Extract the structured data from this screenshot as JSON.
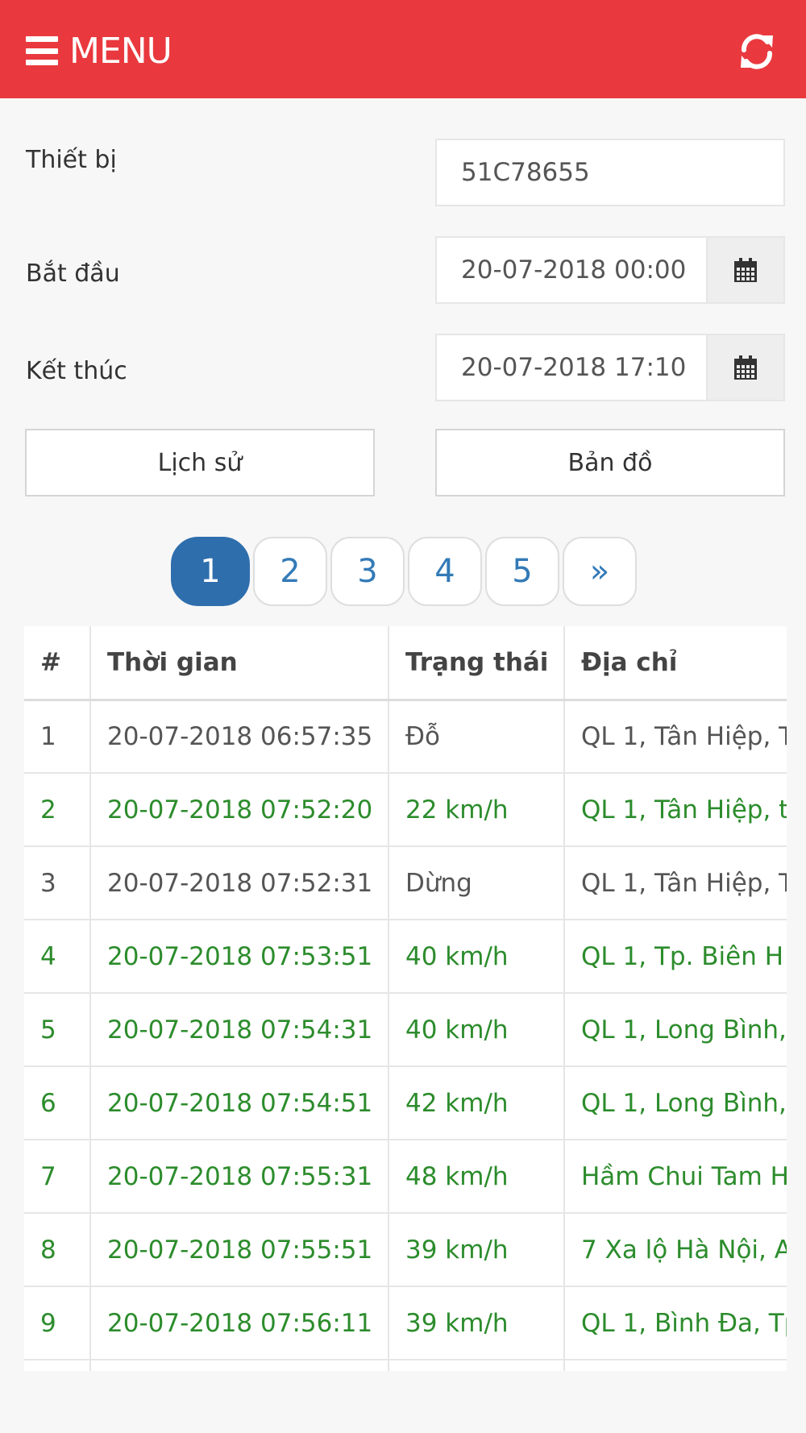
{
  "header": {
    "menu_label": "MENU",
    "menu_icon": "hamburger-icon",
    "refresh_icon": "refresh-icon",
    "accent": "#e9393e"
  },
  "form": {
    "device_label": "Thiết bị",
    "device_value": "51C78655",
    "start_label": "Bắt đầu",
    "start_value": "20-07-2018 00:00",
    "end_label": "Kết thúc",
    "end_value": "20-07-2018 17:10",
    "calendar_icon": "calendar-icon"
  },
  "buttons": {
    "history": "Lịch sử",
    "map": "Bản đồ"
  },
  "pagination": {
    "pages": [
      "1",
      "2",
      "3",
      "4",
      "5"
    ],
    "next": "»",
    "active": "1"
  },
  "table": {
    "headers": [
      "#",
      "Thời gian",
      "Trạng thái",
      "Địa chỉ"
    ],
    "rows": [
      {
        "no": "1",
        "time": "20-07-2018 06:57:35",
        "status": "Đỗ",
        "address": "QL 1, Tân Hiệp, T",
        "moving": false
      },
      {
        "no": "2",
        "time": "20-07-2018 07:52:20",
        "status": "22 km/h",
        "address": "QL 1, Tân Hiệp, t",
        "moving": true
      },
      {
        "no": "3",
        "time": "20-07-2018 07:52:31",
        "status": "Dừng",
        "address": "QL 1, Tân Hiệp, T",
        "moving": false
      },
      {
        "no": "4",
        "time": "20-07-2018 07:53:51",
        "status": "40 km/h",
        "address": "QL 1, Tp. Biên H",
        "moving": true
      },
      {
        "no": "5",
        "time": "20-07-2018 07:54:31",
        "status": "40 km/h",
        "address": "QL 1, Long Bình,",
        "moving": true
      },
      {
        "no": "6",
        "time": "20-07-2018 07:54:51",
        "status": "42 km/h",
        "address": "QL 1, Long Bình,",
        "moving": true
      },
      {
        "no": "7",
        "time": "20-07-2018 07:55:31",
        "status": "48 km/h",
        "address": "Hầm Chui Tam H",
        "moving": true
      },
      {
        "no": "8",
        "time": "20-07-2018 07:55:51",
        "status": "39 km/h",
        "address": "7 Xa lộ Hà Nội, A",
        "moving": true
      },
      {
        "no": "9",
        "time": "20-07-2018 07:56:11",
        "status": "39 km/h",
        "address": "QL 1, Bình Đa, Tp",
        "moving": true
      }
    ],
    "moving_color": "#2c8c2c",
    "stopped_color": "#555555"
  }
}
